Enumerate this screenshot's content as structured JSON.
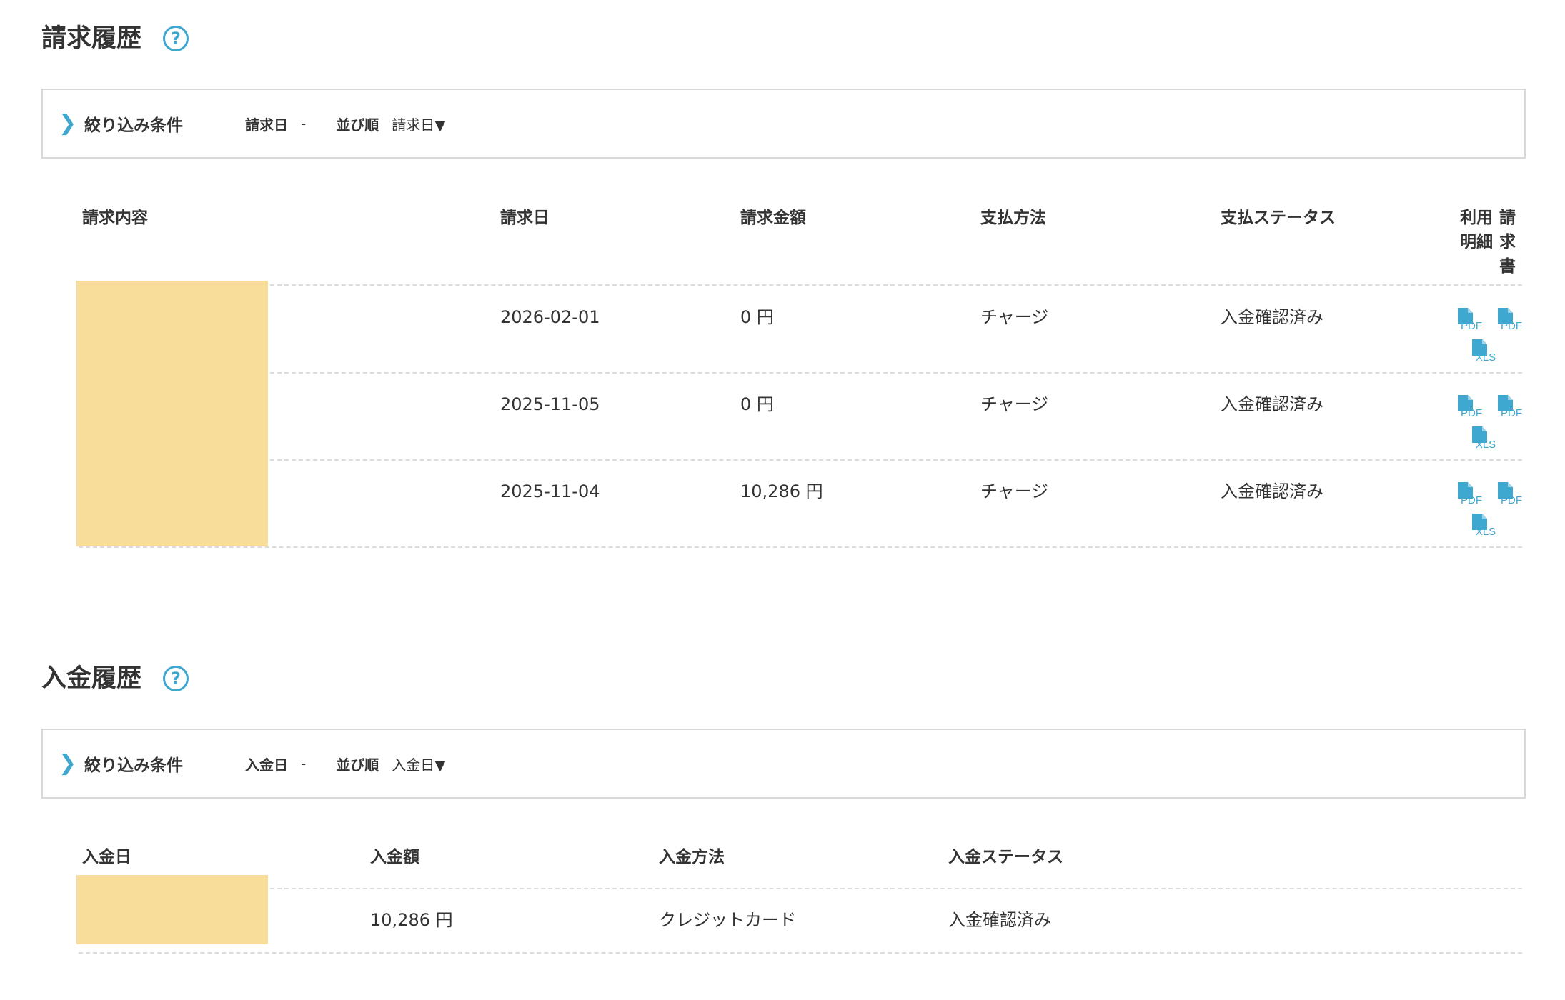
{
  "billing": {
    "title": "請求履歴",
    "help_icon": "?",
    "filter": {
      "chevron": "❯",
      "title": "絞り込み条件",
      "date_label": "請求日",
      "date_value": "-",
      "sort_label": "並び順",
      "sort_value": "請求日▼"
    },
    "columns": {
      "content": "請求内容",
      "date": "請求日",
      "amount": "請求金額",
      "method": "支払方法",
      "status": "支払ステータス",
      "usage_line1": "利用",
      "usage_line2": "明細",
      "invoice_line1": "請",
      "invoice_line2": "求",
      "invoice_line3": "書"
    },
    "rows": [
      {
        "date": "2026-02-01",
        "amount": "0 円",
        "method": "チャージ",
        "status": "入金確認済み"
      },
      {
        "date": "2025-11-05",
        "amount": "0 円",
        "method": "チャージ",
        "status": "入金確認済み"
      },
      {
        "date": "2025-11-04",
        "amount": "10,286 円",
        "method": "チャージ",
        "status": "入金確認済み"
      }
    ],
    "file_labels": {
      "pdf": "PDF",
      "xls": "XLS"
    }
  },
  "payment": {
    "title": "入金履歴",
    "help_icon": "?",
    "filter": {
      "chevron": "❯",
      "title": "絞り込み条件",
      "date_label": "入金日",
      "date_value": "-",
      "sort_label": "並び順",
      "sort_value": "入金日▼"
    },
    "columns": {
      "date": "入金日",
      "amount": "入金額",
      "method": "入金方法",
      "status": "入金ステータス"
    },
    "rows": [
      {
        "amount": "10,286 円",
        "method": "クレジットカード",
        "status": "入金確認済み"
      }
    ]
  },
  "colors": {
    "accent": "#3fa8d0",
    "redaction": "#f8dc99",
    "border": "#d8d8d8"
  },
  "icons": [
    "help-icon",
    "chevron-right-icon",
    "pdf-file-icon",
    "xls-file-icon"
  ]
}
